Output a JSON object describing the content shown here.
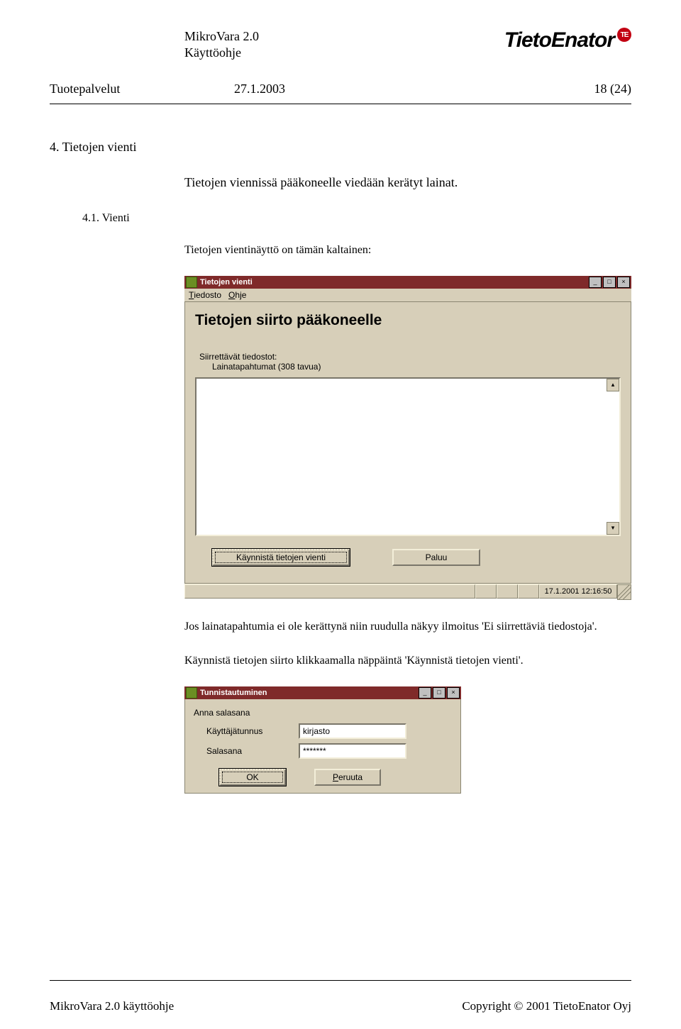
{
  "header": {
    "product": "MikroVara 2.0",
    "doc_title": "Käyttöohje",
    "brand": "TietoEnator",
    "brand_badge": "TE"
  },
  "meta": {
    "left": "Tuotepalvelut",
    "date": "27.1.2003",
    "page": "18 (24)"
  },
  "s4": {
    "title": "4. Tietojen vienti",
    "para": "Tietojen viennissä pääkoneelle viedään kerätyt lainat."
  },
  "s41": {
    "title": "4.1. Vienti",
    "para": "Tietojen vientinäyttö on tämän kaltainen:"
  },
  "win1": {
    "title": "Tietojen vienti",
    "menu_tiedosto": "Tiedosto",
    "menu_ohje": "Ohje",
    "panel_title": "Tietojen siirto pääkoneelle",
    "label_files": "Siirrettävät tiedostot:",
    "file_line": "Lainatapahtumat (308 tavua)",
    "btn_start": "Käynnistä tietojen vienti",
    "btn_back": "Paluu",
    "status_time": "17.1.2001 12:16:50",
    "tb_min": "_",
    "tb_max": "□",
    "tb_close": "×",
    "scroll_up": "▴",
    "scroll_dn": "▾"
  },
  "after1": {
    "p1": "Jos lainatapahtumia ei ole kerättynä niin ruudulla näkyy ilmoitus 'Ei siirrettäviä tiedostoja'.",
    "p2": "Käynnistä tietojen siirto klikkaamalla näppäintä 'Käynnistä tietojen vienti'."
  },
  "win2": {
    "title": "Tunnistautuminen",
    "prompt": "Anna salasana",
    "user_label": "Käyttäjätunnus",
    "pass_label": "Salasana",
    "user_value": "kirjasto",
    "pass_value": "*******",
    "btn_ok": "OK",
    "btn_cancel": "Peruuta",
    "tb_min": "_",
    "tb_max": "□",
    "tb_close": "×"
  },
  "footer": {
    "left": "MikroVara 2.0 käyttöohje",
    "right": "Copyright © 2001 TietoEnator Oyj"
  }
}
